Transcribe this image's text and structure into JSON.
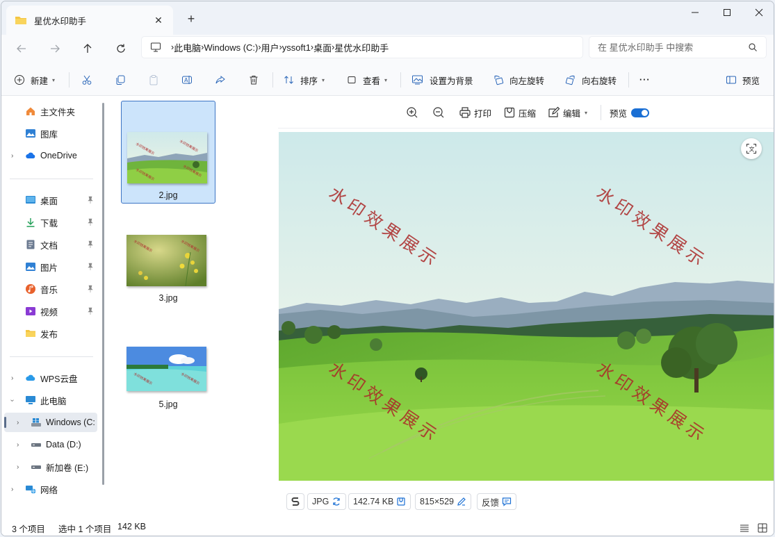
{
  "window": {
    "tab_title": "星优水印助手",
    "new_tab": "+",
    "close_tab": "✕"
  },
  "nav": {
    "breadcrumb": [
      "此电脑",
      "Windows (C:)",
      "用户",
      "yssoft1",
      "桌面",
      "星优水印助手"
    ],
    "search_placeholder": "在 星优水印助手 中搜索"
  },
  "toolbar": {
    "new": "新建",
    "sort": "排序",
    "view": "查看",
    "set_background": "设置为背景",
    "rotate_left": "向左旋转",
    "rotate_right": "向右旋转",
    "more": "···",
    "preview": "预览"
  },
  "sidebar": {
    "items": [
      {
        "label": "主文件夹",
        "icon": "home-icon"
      },
      {
        "label": "图库",
        "icon": "gallery-icon"
      },
      {
        "label": "OneDrive",
        "icon": "cloud-icon"
      },
      {
        "label": "桌面",
        "icon": "desktop-icon"
      },
      {
        "label": "下载",
        "icon": "download-icon"
      },
      {
        "label": "文档",
        "icon": "document-icon"
      },
      {
        "label": "图片",
        "icon": "pictures-icon"
      },
      {
        "label": "音乐",
        "icon": "music-icon"
      },
      {
        "label": "视频",
        "icon": "video-icon"
      },
      {
        "label": "发布",
        "icon": "folder-icon"
      },
      {
        "label": "WPS云盘",
        "icon": "wps-cloud-icon"
      },
      {
        "label": "此电脑",
        "icon": "pc-icon"
      },
      {
        "label": "Windows (C:",
        "icon": "windows-drive-icon"
      },
      {
        "label": "Data (D:)",
        "icon": "drive-icon"
      },
      {
        "label": "新加卷 (E:)",
        "icon": "drive-icon"
      },
      {
        "label": "网络",
        "icon": "network-icon"
      }
    ]
  },
  "files": [
    {
      "name": "2.jpg",
      "selected": true
    },
    {
      "name": "3.jpg",
      "selected": false
    },
    {
      "name": "5.jpg",
      "selected": false
    }
  ],
  "preview": {
    "zoom_in": "",
    "print": "打印",
    "compress": "压缩",
    "edit": "编辑",
    "preview_toggle": "预览",
    "watermark_text": "水印效果展示",
    "format": "JPG",
    "size": "142.74 KB",
    "dimensions": "815×529",
    "feedback": "反馈"
  },
  "status": {
    "count": "3 个项目",
    "selected": "选中 1 个项目",
    "selected_size": "142 KB"
  },
  "colors": {
    "accent": "#1a6fd4",
    "selection": "#cce4fb",
    "watermark": "#aa2828"
  }
}
